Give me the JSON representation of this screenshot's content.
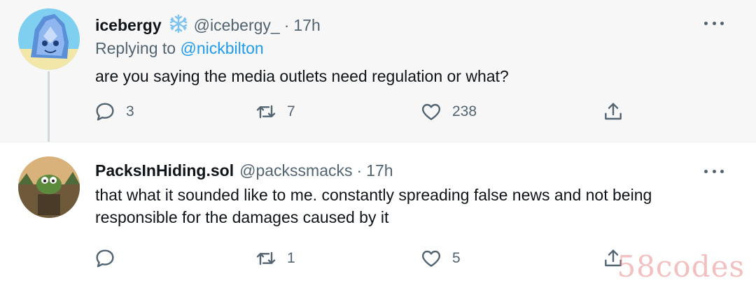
{
  "tweets": [
    {
      "display_name": "icebergy",
      "badge_icon": "snowflake-icon",
      "handle": "@icebergy_",
      "separator": "·",
      "time": "17h",
      "replying_prefix": "Replying to",
      "replying_to": "@nickbilton",
      "text": "are you saying the media outlets need regulation or what?",
      "replies": "3",
      "retweets": "7",
      "likes": "238"
    },
    {
      "display_name": "PacksInHiding.sol",
      "handle": "@packssmacks",
      "separator": "·",
      "time": "17h",
      "text": "that what it sounded like to me. constantly spreading false news and not being responsible for the damages caused by it",
      "replies": "",
      "retweets": "1",
      "likes": "5"
    }
  ],
  "watermark": "58codes",
  "colors": {
    "accent": "#1d9bf0",
    "secondary_text": "#536471",
    "primary_text": "#0f1419",
    "highlight_bg": "#f7f7f7"
  }
}
